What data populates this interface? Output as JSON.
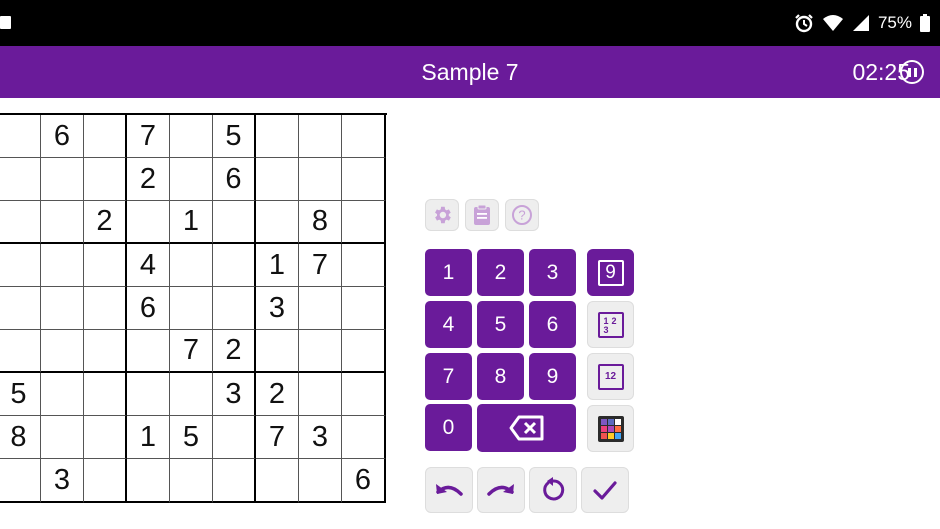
{
  "status_bar": {
    "battery_text": "75%"
  },
  "app_bar": {
    "title": "Sample 7",
    "timer": "02:25"
  },
  "board": [
    [
      "",
      "6",
      "",
      "7",
      "",
      "5",
      "",
      "",
      ""
    ],
    [
      "",
      "",
      "",
      "2",
      "",
      "6",
      "",
      "",
      ""
    ],
    [
      "",
      "",
      "2",
      "",
      "1",
      "",
      "",
      "8",
      ""
    ],
    [
      "",
      "",
      "",
      "4",
      "",
      "",
      "1",
      "7",
      ""
    ],
    [
      "",
      "",
      "",
      "6",
      "",
      "",
      "3",
      "",
      ""
    ],
    [
      "",
      "",
      "",
      "",
      "7",
      "2",
      "",
      "",
      ""
    ],
    [
      "5",
      "",
      "",
      "",
      "",
      "3",
      "2",
      "",
      ""
    ],
    [
      "8",
      "",
      "",
      "1",
      "5",
      "",
      "7",
      "3",
      ""
    ],
    [
      "",
      "3",
      "",
      "",
      "",
      "",
      "",
      "",
      "6"
    ]
  ],
  "keypad": {
    "digits": [
      "1",
      "2",
      "3",
      "4",
      "5",
      "6",
      "7",
      "8",
      "9",
      "0"
    ],
    "mode_big_label": "9",
    "mode_pencil_labels": [
      "1",
      "2",
      "3"
    ],
    "mode_notes_label": "12"
  },
  "colors": {
    "primary": "#6a1b9a",
    "tool_icon": "#c8a2d8",
    "button_bg": "#eeeeee"
  },
  "icons": {
    "tools": [
      "gear-icon",
      "clipboard-icon",
      "help-icon"
    ],
    "actions": [
      "undo-icon",
      "redo-icon",
      "restart-icon",
      "check-icon"
    ],
    "backspace": "backspace-icon",
    "palette": "color-palette-icon"
  }
}
